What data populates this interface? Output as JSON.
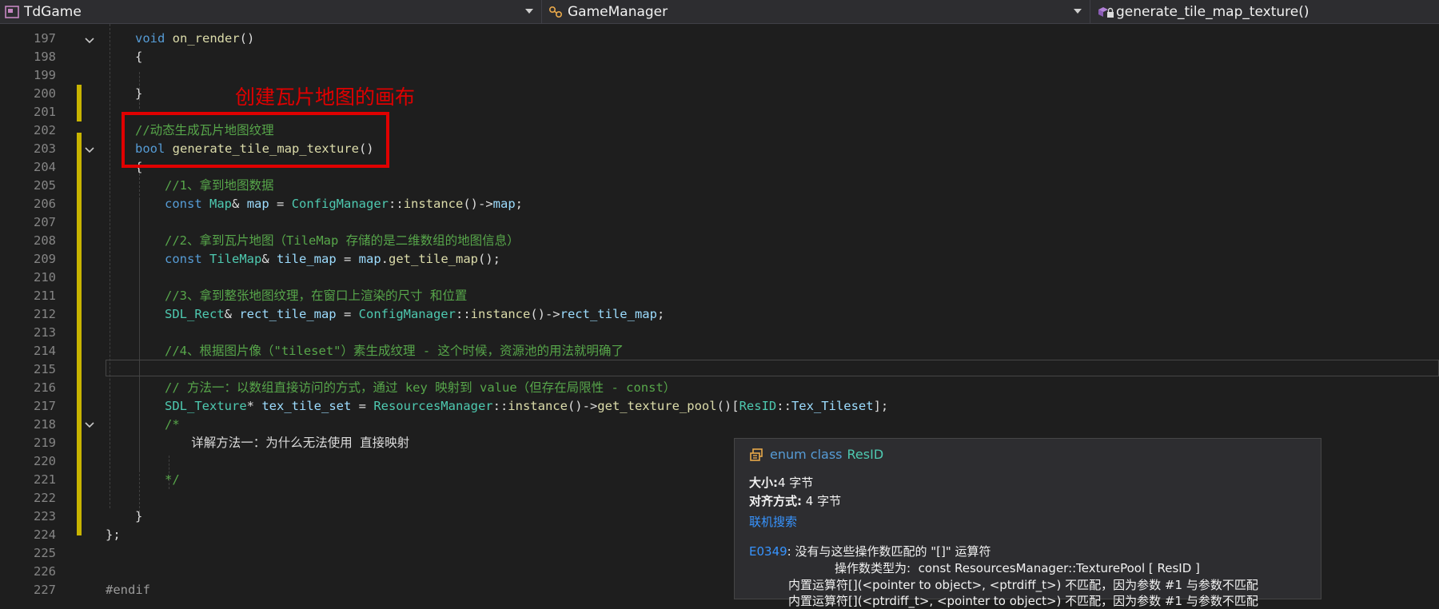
{
  "nav": {
    "project": "TdGame",
    "class": "GameManager",
    "member": "generate_tile_map_texture()"
  },
  "annotation": {
    "label": "创建瓦片地图的画布"
  },
  "code_lines": [
    {
      "n": "197",
      "t": "void on_render()"
    },
    {
      "n": "198",
      "t": "{"
    },
    {
      "n": "199",
      "t": ""
    },
    {
      "n": "200",
      "t": "}"
    },
    {
      "n": "201",
      "t": ""
    },
    {
      "n": "202",
      "t": "//动态生成瓦片地图纹理"
    },
    {
      "n": "203",
      "t": "bool generate_tile_map_texture()"
    },
    {
      "n": "204",
      "t": "{"
    },
    {
      "n": "205",
      "t": "//1、拿到地图数据"
    },
    {
      "n": "206",
      "t": "const Map& map = ConfigManager::instance()->map;"
    },
    {
      "n": "207",
      "t": ""
    },
    {
      "n": "208",
      "t": "//2、拿到瓦片地图（TileMap 存储的是二维数组的地图信息）"
    },
    {
      "n": "209",
      "t": "const TileMap& tile_map = map.get_tile_map();"
    },
    {
      "n": "210",
      "t": ""
    },
    {
      "n": "211",
      "t": "//3、拿到整张地图纹理，在窗口上渲染的尺寸 和位置"
    },
    {
      "n": "212",
      "t": "SDL_Rect& rect_tile_map = ConfigManager::instance()->rect_tile_map;"
    },
    {
      "n": "213",
      "t": ""
    },
    {
      "n": "214",
      "t": "//4、根据图片像（\"tileset\"）素生成纹理 - 这个时候，资源池的用法就明确了"
    },
    {
      "n": "215",
      "t": ""
    },
    {
      "n": "216",
      "t": "// 方法一：以数组直接访问的方式，通过 key 映射到 value（但存在局限性 - const）"
    },
    {
      "n": "217",
      "t": "SDL_Texture* tex_tile_set = ResourcesManager::instance()->get_texture_pool()[ResID::Tex_Tileset];"
    },
    {
      "n": "218",
      "t": "/*"
    },
    {
      "n": "219",
      "t": "详解方法一：为什么无法使用 直接映射"
    },
    {
      "n": "220",
      "t": ""
    },
    {
      "n": "221",
      "t": "*/"
    },
    {
      "n": "222",
      "t": ""
    },
    {
      "n": "223",
      "t": "}"
    },
    {
      "n": "224",
      "t": "};"
    },
    {
      "n": "225",
      "t": ""
    },
    {
      "n": "226",
      "t": ""
    },
    {
      "n": "227",
      "t": "#endif"
    }
  ],
  "tooltip": {
    "kind": "enum class",
    "name": "ResID",
    "size_label": "大小:",
    "size_value": "4 字节",
    "align_label": "对齐方式:",
    "align_value": " 4 字节",
    "link": "联机搜索",
    "error_code": "E0349",
    "error_msg": ": 没有与这些操作数匹配的 \"[]\" 运算符",
    "operand_line": "操作数类型为:  const ResourcesManager::TexturePool [ ResID ]",
    "detail_1": "内置运算符[](<pointer to object>, <ptrdiff_t>) 不匹配，因为参数 #1 与参数不匹配",
    "detail_2": "内置运算符[](<ptrdiff_t>, <pointer to object>) 不匹配，因为参数 #1 与参数不匹配"
  },
  "colors": {
    "background": "#1e1e1e",
    "keyword": "#569cd6",
    "type": "#4ec9b0",
    "comment": "#57a64a",
    "annotation": "#e00000",
    "change_bar": "#c8b400"
  }
}
